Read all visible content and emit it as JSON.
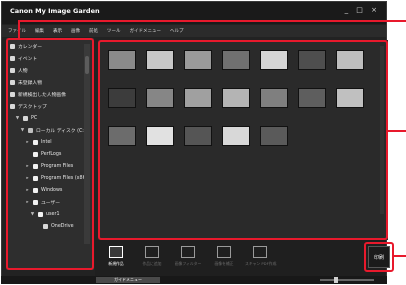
{
  "app": {
    "title": "Canon My Image Garden",
    "window_buttons": "_ □ ×"
  },
  "menu": [
    "ファイル",
    "編集",
    "表示",
    "画像",
    "前処",
    "ツール",
    "ガイドメニュー",
    "ヘルプ"
  ],
  "sidebar": {
    "items": [
      {
        "label": "カレンダー",
        "indent": 0,
        "icon": "calendar-icon"
      },
      {
        "label": "イベント",
        "indent": 0,
        "icon": "event-icon"
      },
      {
        "label": "人物",
        "indent": 0,
        "icon": "person-icon"
      },
      {
        "label": "未登録人物",
        "indent": 0,
        "icon": "unregistered-person-icon"
      },
      {
        "label": "新規検出した人物画像",
        "indent": 0,
        "icon": "detect-icon"
      },
      {
        "label": "デスクトップ",
        "indent": 0,
        "icon": "desktop-icon"
      },
      {
        "label": "PC",
        "indent": 1,
        "arrow": "▼",
        "icon": "pc-icon"
      },
      {
        "label": "ローカル ディスク (C:)",
        "indent": 2,
        "arrow": "▼",
        "icon": "drive-icon"
      },
      {
        "label": "Intel",
        "indent": 3,
        "arrow": "▸",
        "icon": "folder-icon"
      },
      {
        "label": "PerfLogs",
        "indent": 3,
        "arrow": "",
        "icon": "folder-icon"
      },
      {
        "label": "Program Files",
        "indent": 3,
        "arrow": "▸",
        "icon": "folder-icon"
      },
      {
        "label": "Program Files (x86)",
        "indent": 3,
        "arrow": "▸",
        "icon": "folder-icon"
      },
      {
        "label": "Windows",
        "indent": 3,
        "arrow": "▸",
        "icon": "folder-icon"
      },
      {
        "label": "ユーザー",
        "indent": 3,
        "arrow": "▸",
        "icon": "folder-icon"
      },
      {
        "label": "user1",
        "indent": 4,
        "arrow": "▼",
        "icon": "folder-icon"
      },
      {
        "label": "OneDrive",
        "indent": 5,
        "arrow": "",
        "icon": "cloud-icon"
      }
    ]
  },
  "thumbnails": [
    "#8a8a8a",
    "#c7c7c7",
    "#9a9a9a",
    "#707070",
    "#d5d5d5",
    "#4e4e4e",
    "#bdbdbd",
    "#3c3c3c",
    "#868686",
    "#a0a0a0",
    "#b4b4b4",
    "#7f7f7f",
    "#5e5e5e",
    "#c0c0c0",
    "#6c6c6c",
    "#e1e1e1",
    "#555555",
    "#d8d8d8",
    "#5a5a5a"
  ],
  "toolbar": {
    "items": [
      {
        "label": "新規作品",
        "icon": "new-work-icon",
        "active": true
      },
      {
        "label": "作品に追加",
        "icon": "add-to-work-icon",
        "active": false
      },
      {
        "label": "画像フィルター",
        "icon": "image-filter-icon",
        "active": false
      },
      {
        "label": "画像を補正",
        "icon": "image-correct-icon",
        "active": false
      },
      {
        "label": "スキャン\nPDF作成",
        "icon": "pdf-icon",
        "active": false
      }
    ],
    "print_label": "印刷"
  },
  "status": {
    "guide_menu_label": "ガイドメニュー",
    "zoom_fraction": 0.28
  },
  "colors": {
    "highlight": "#e8192c"
  }
}
